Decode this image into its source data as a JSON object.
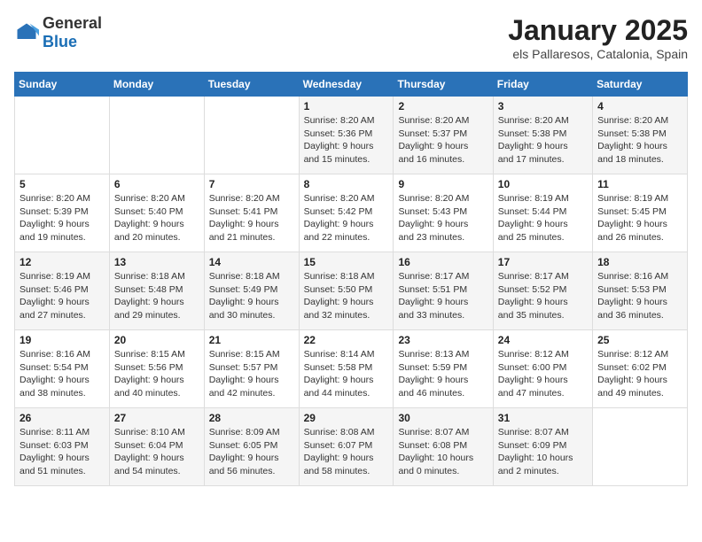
{
  "header": {
    "logo_general": "General",
    "logo_blue": "Blue",
    "month_title": "January 2025",
    "location": "els Pallaresos, Catalonia, Spain"
  },
  "weekdays": [
    "Sunday",
    "Monday",
    "Tuesday",
    "Wednesday",
    "Thursday",
    "Friday",
    "Saturday"
  ],
  "weeks": [
    [
      {
        "day": "",
        "info": ""
      },
      {
        "day": "",
        "info": ""
      },
      {
        "day": "",
        "info": ""
      },
      {
        "day": "1",
        "info": "Sunrise: 8:20 AM\nSunset: 5:36 PM\nDaylight: 9 hours\nand 15 minutes."
      },
      {
        "day": "2",
        "info": "Sunrise: 8:20 AM\nSunset: 5:37 PM\nDaylight: 9 hours\nand 16 minutes."
      },
      {
        "day": "3",
        "info": "Sunrise: 8:20 AM\nSunset: 5:38 PM\nDaylight: 9 hours\nand 17 minutes."
      },
      {
        "day": "4",
        "info": "Sunrise: 8:20 AM\nSunset: 5:38 PM\nDaylight: 9 hours\nand 18 minutes."
      }
    ],
    [
      {
        "day": "5",
        "info": "Sunrise: 8:20 AM\nSunset: 5:39 PM\nDaylight: 9 hours\nand 19 minutes."
      },
      {
        "day": "6",
        "info": "Sunrise: 8:20 AM\nSunset: 5:40 PM\nDaylight: 9 hours\nand 20 minutes."
      },
      {
        "day": "7",
        "info": "Sunrise: 8:20 AM\nSunset: 5:41 PM\nDaylight: 9 hours\nand 21 minutes."
      },
      {
        "day": "8",
        "info": "Sunrise: 8:20 AM\nSunset: 5:42 PM\nDaylight: 9 hours\nand 22 minutes."
      },
      {
        "day": "9",
        "info": "Sunrise: 8:20 AM\nSunset: 5:43 PM\nDaylight: 9 hours\nand 23 minutes."
      },
      {
        "day": "10",
        "info": "Sunrise: 8:19 AM\nSunset: 5:44 PM\nDaylight: 9 hours\nand 25 minutes."
      },
      {
        "day": "11",
        "info": "Sunrise: 8:19 AM\nSunset: 5:45 PM\nDaylight: 9 hours\nand 26 minutes."
      }
    ],
    [
      {
        "day": "12",
        "info": "Sunrise: 8:19 AM\nSunset: 5:46 PM\nDaylight: 9 hours\nand 27 minutes."
      },
      {
        "day": "13",
        "info": "Sunrise: 8:18 AM\nSunset: 5:48 PM\nDaylight: 9 hours\nand 29 minutes."
      },
      {
        "day": "14",
        "info": "Sunrise: 8:18 AM\nSunset: 5:49 PM\nDaylight: 9 hours\nand 30 minutes."
      },
      {
        "day": "15",
        "info": "Sunrise: 8:18 AM\nSunset: 5:50 PM\nDaylight: 9 hours\nand 32 minutes."
      },
      {
        "day": "16",
        "info": "Sunrise: 8:17 AM\nSunset: 5:51 PM\nDaylight: 9 hours\nand 33 minutes."
      },
      {
        "day": "17",
        "info": "Sunrise: 8:17 AM\nSunset: 5:52 PM\nDaylight: 9 hours\nand 35 minutes."
      },
      {
        "day": "18",
        "info": "Sunrise: 8:16 AM\nSunset: 5:53 PM\nDaylight: 9 hours\nand 36 minutes."
      }
    ],
    [
      {
        "day": "19",
        "info": "Sunrise: 8:16 AM\nSunset: 5:54 PM\nDaylight: 9 hours\nand 38 minutes."
      },
      {
        "day": "20",
        "info": "Sunrise: 8:15 AM\nSunset: 5:56 PM\nDaylight: 9 hours\nand 40 minutes."
      },
      {
        "day": "21",
        "info": "Sunrise: 8:15 AM\nSunset: 5:57 PM\nDaylight: 9 hours\nand 42 minutes."
      },
      {
        "day": "22",
        "info": "Sunrise: 8:14 AM\nSunset: 5:58 PM\nDaylight: 9 hours\nand 44 minutes."
      },
      {
        "day": "23",
        "info": "Sunrise: 8:13 AM\nSunset: 5:59 PM\nDaylight: 9 hours\nand 46 minutes."
      },
      {
        "day": "24",
        "info": "Sunrise: 8:12 AM\nSunset: 6:00 PM\nDaylight: 9 hours\nand 47 minutes."
      },
      {
        "day": "25",
        "info": "Sunrise: 8:12 AM\nSunset: 6:02 PM\nDaylight: 9 hours\nand 49 minutes."
      }
    ],
    [
      {
        "day": "26",
        "info": "Sunrise: 8:11 AM\nSunset: 6:03 PM\nDaylight: 9 hours\nand 51 minutes."
      },
      {
        "day": "27",
        "info": "Sunrise: 8:10 AM\nSunset: 6:04 PM\nDaylight: 9 hours\nand 54 minutes."
      },
      {
        "day": "28",
        "info": "Sunrise: 8:09 AM\nSunset: 6:05 PM\nDaylight: 9 hours\nand 56 minutes."
      },
      {
        "day": "29",
        "info": "Sunrise: 8:08 AM\nSunset: 6:07 PM\nDaylight: 9 hours\nand 58 minutes."
      },
      {
        "day": "30",
        "info": "Sunrise: 8:07 AM\nSunset: 6:08 PM\nDaylight: 10 hours\nand 0 minutes."
      },
      {
        "day": "31",
        "info": "Sunrise: 8:07 AM\nSunset: 6:09 PM\nDaylight: 10 hours\nand 2 minutes."
      },
      {
        "day": "",
        "info": ""
      }
    ]
  ]
}
